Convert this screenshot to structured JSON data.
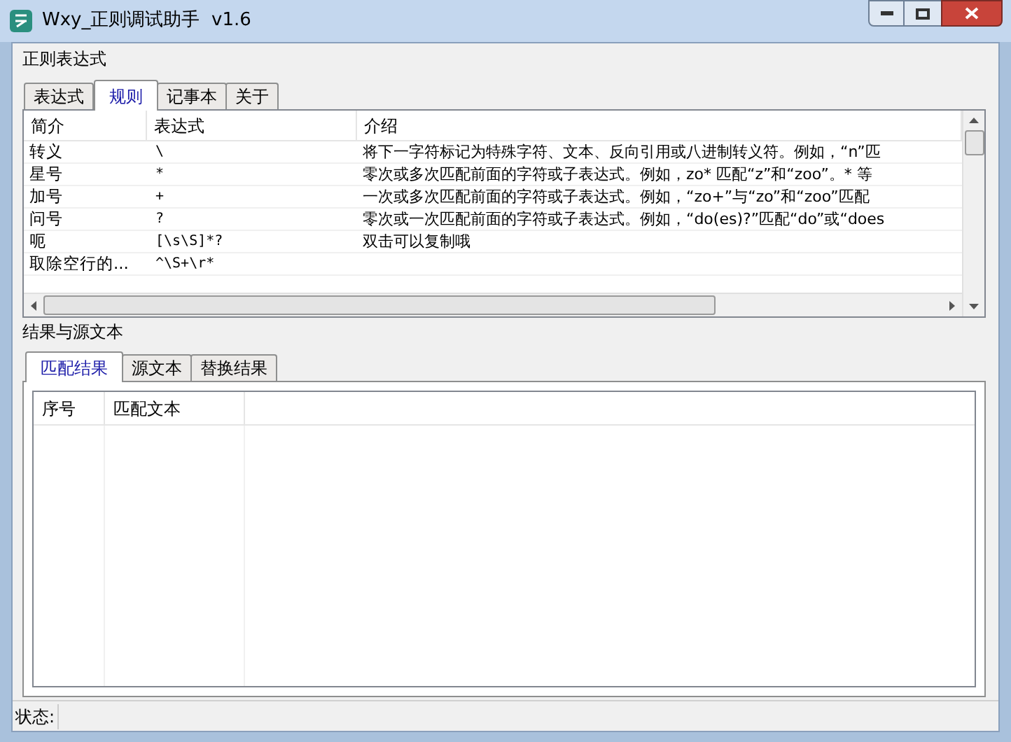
{
  "window": {
    "title": "Wxy_正则调试助手  v1.6"
  },
  "regex_group": {
    "title": "正则表达式",
    "tabs": [
      {
        "label": "表达式",
        "selected": false
      },
      {
        "label": "规则",
        "selected": true
      },
      {
        "label": "记事本",
        "selected": false
      },
      {
        "label": "关于",
        "selected": false
      }
    ],
    "table": {
      "columns": [
        "简介",
        "表达式",
        "介绍"
      ],
      "rows": [
        [
          "转义",
          "\\",
          "将下一字符标记为特殊字符、文本、反向引用或八进制转义符。例如，“n”匹"
        ],
        [
          "星号",
          "*",
          "零次或多次匹配前面的字符或子表达式。例如，zo* 匹配“z”和“zoo”。* 等"
        ],
        [
          "加号",
          "+",
          "一次或多次匹配前面的字符或子表达式。例如，“zo+”与“zo”和“zoo”匹配"
        ],
        [
          "问号",
          "?",
          "零次或一次匹配前面的字符或子表达式。例如，“do(es)?”匹配“do”或“does"
        ],
        [
          "呃",
          "[\\s\\S]*?",
          "双击可以复制哦"
        ],
        [
          "取除空行的...",
          "^\\S+\\r*",
          ""
        ]
      ]
    }
  },
  "result_group": {
    "title": "结果与源文本",
    "tabs": [
      {
        "label": "匹配结果",
        "selected": true
      },
      {
        "label": "源文本",
        "selected": false
      },
      {
        "label": "替换结果",
        "selected": false
      }
    ],
    "table": {
      "columns": [
        "序号",
        "匹配文本"
      ]
    }
  },
  "status_bar": {
    "label": "状态:"
  }
}
